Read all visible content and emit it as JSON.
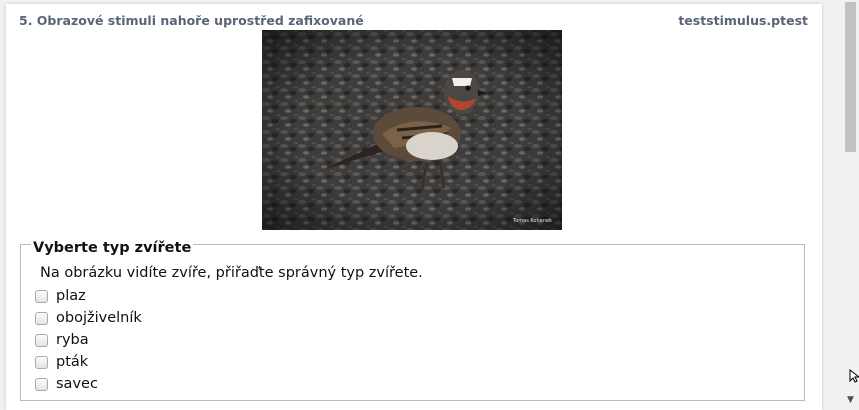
{
  "question": {
    "title": "5. Obrazové stimuli nahoře uprostřed zafixované",
    "file": "teststimulus.ptest"
  },
  "image": {
    "watermark": "Tomas Kohanek",
    "subject": "bird-on-gravel"
  },
  "form": {
    "legend": "Vyberte typ zvířete",
    "instruction": "Na obrázku vidíte zvíře, přiřaďte správný typ zvířete.",
    "options": [
      {
        "label": "plaz",
        "checked": false
      },
      {
        "label": "obojživelník",
        "checked": false
      },
      {
        "label": "ryba",
        "checked": false
      },
      {
        "label": "pták",
        "checked": false
      },
      {
        "label": "savec",
        "checked": false
      }
    ]
  },
  "colors": {
    "header_text": "#5a6478",
    "page_bg": "#f0f0f0"
  }
}
